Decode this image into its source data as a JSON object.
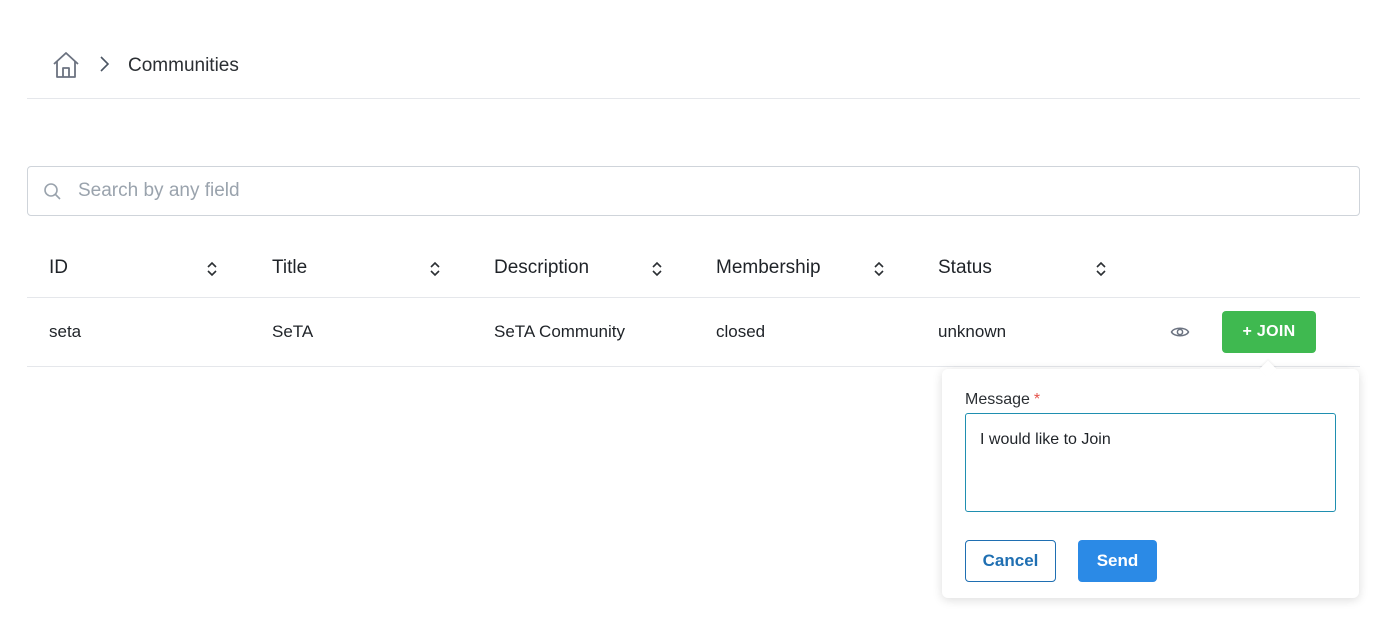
{
  "breadcrumb": {
    "home_icon": "home-icon",
    "separator_icon": "chevron-right-icon",
    "current": "Communities"
  },
  "search": {
    "icon": "search-icon",
    "placeholder": "Search by any field",
    "value": ""
  },
  "table": {
    "columns": [
      {
        "label": "ID",
        "sortable": true
      },
      {
        "label": "Title",
        "sortable": true
      },
      {
        "label": "Description",
        "sortable": true
      },
      {
        "label": "Membership",
        "sortable": true
      },
      {
        "label": "Status",
        "sortable": true
      }
    ],
    "rows": [
      {
        "id": "seta",
        "title": "SeTA",
        "description": "SeTA Community",
        "membership": "closed",
        "status": "unknown",
        "view_icon": "eye-icon",
        "join_label": "+ JOIN"
      }
    ]
  },
  "join_popover": {
    "message_label": "Message",
    "required_mark": "*",
    "message_value": "I would like to Join",
    "cancel_label": "Cancel",
    "send_label": "Send"
  },
  "colors": {
    "join_button": "#3fb950",
    "send_button": "#2b8ae6",
    "cancel_border": "#1f6fb2",
    "textarea_focus_border": "#1f8fb0",
    "required_mark": "#e5534b"
  }
}
